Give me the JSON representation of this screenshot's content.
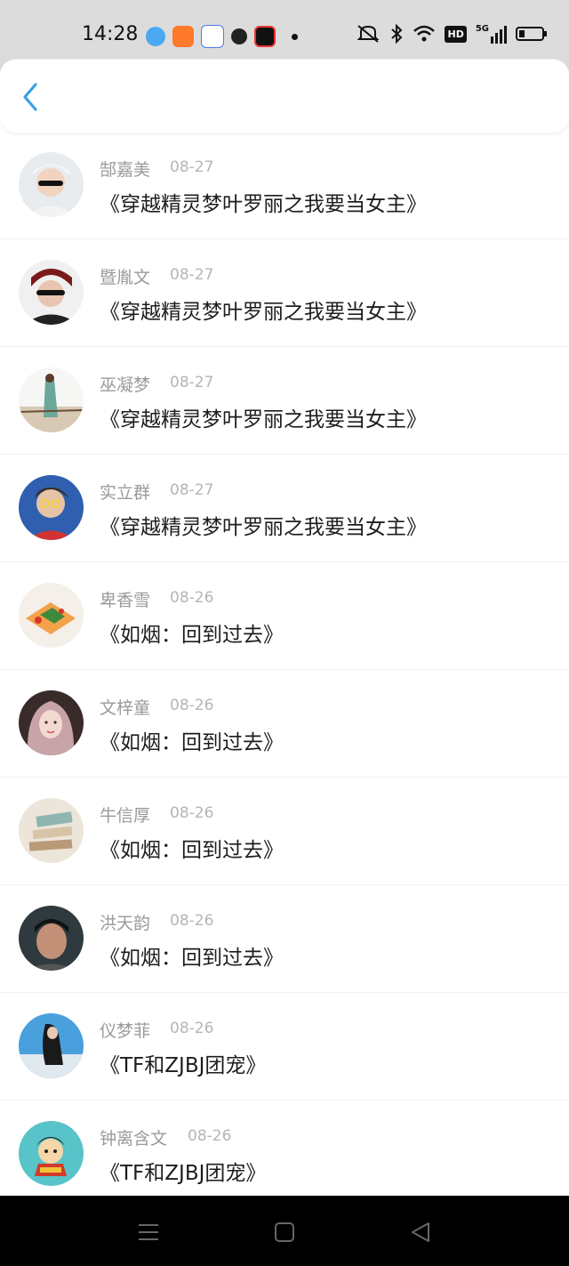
{
  "status": {
    "time": "14:28",
    "icons": [
      "app-qq-icon",
      "app-orange-icon",
      "app-baidu-icon",
      "app-penguin-icon",
      "app-video-icon",
      "dot-icon",
      "mute-icon",
      "bluetooth-icon",
      "wifi-icon",
      "hd-icon",
      "5g-signal-icon",
      "battery-icon"
    ],
    "hd": "HD",
    "net": "5G"
  },
  "header": {
    "back_icon": "chevron-left-icon"
  },
  "colors": {
    "accent": "#3aa0e6",
    "name": "#9a9a9a",
    "date": "#b5b5b5",
    "title": "#1d1d1d"
  },
  "list": {
    "items": [
      {
        "name": "郜嘉美",
        "date": "08-27",
        "title": "《穿越精灵梦叶罗丽之我要当女主》"
      },
      {
        "name": "暨胤文",
        "date": "08-27",
        "title": "《穿越精灵梦叶罗丽之我要当女主》"
      },
      {
        "name": "巫凝梦",
        "date": "08-27",
        "title": "《穿越精灵梦叶罗丽之我要当女主》"
      },
      {
        "name": "实立群",
        "date": "08-27",
        "title": "《穿越精灵梦叶罗丽之我要当女主》"
      },
      {
        "name": "卑香雪",
        "date": "08-26",
        "title": "《如烟：回到过去》"
      },
      {
        "name": "文梓童",
        "date": "08-26",
        "title": "《如烟：回到过去》"
      },
      {
        "name": "牛信厚",
        "date": "08-26",
        "title": "《如烟：回到过去》"
      },
      {
        "name": "洪天韵",
        "date": "08-26",
        "title": "《如烟：回到过去》"
      },
      {
        "name": "仪梦菲",
        "date": "08-26",
        "title": "《TF和ZJBJ团宠》"
      },
      {
        "name": "钟离含文",
        "date": "08-26",
        "title": "《TF和ZJBJ团宠》"
      }
    ]
  },
  "nav": {
    "icons": [
      "menu-icon",
      "home-icon",
      "back-icon"
    ]
  }
}
